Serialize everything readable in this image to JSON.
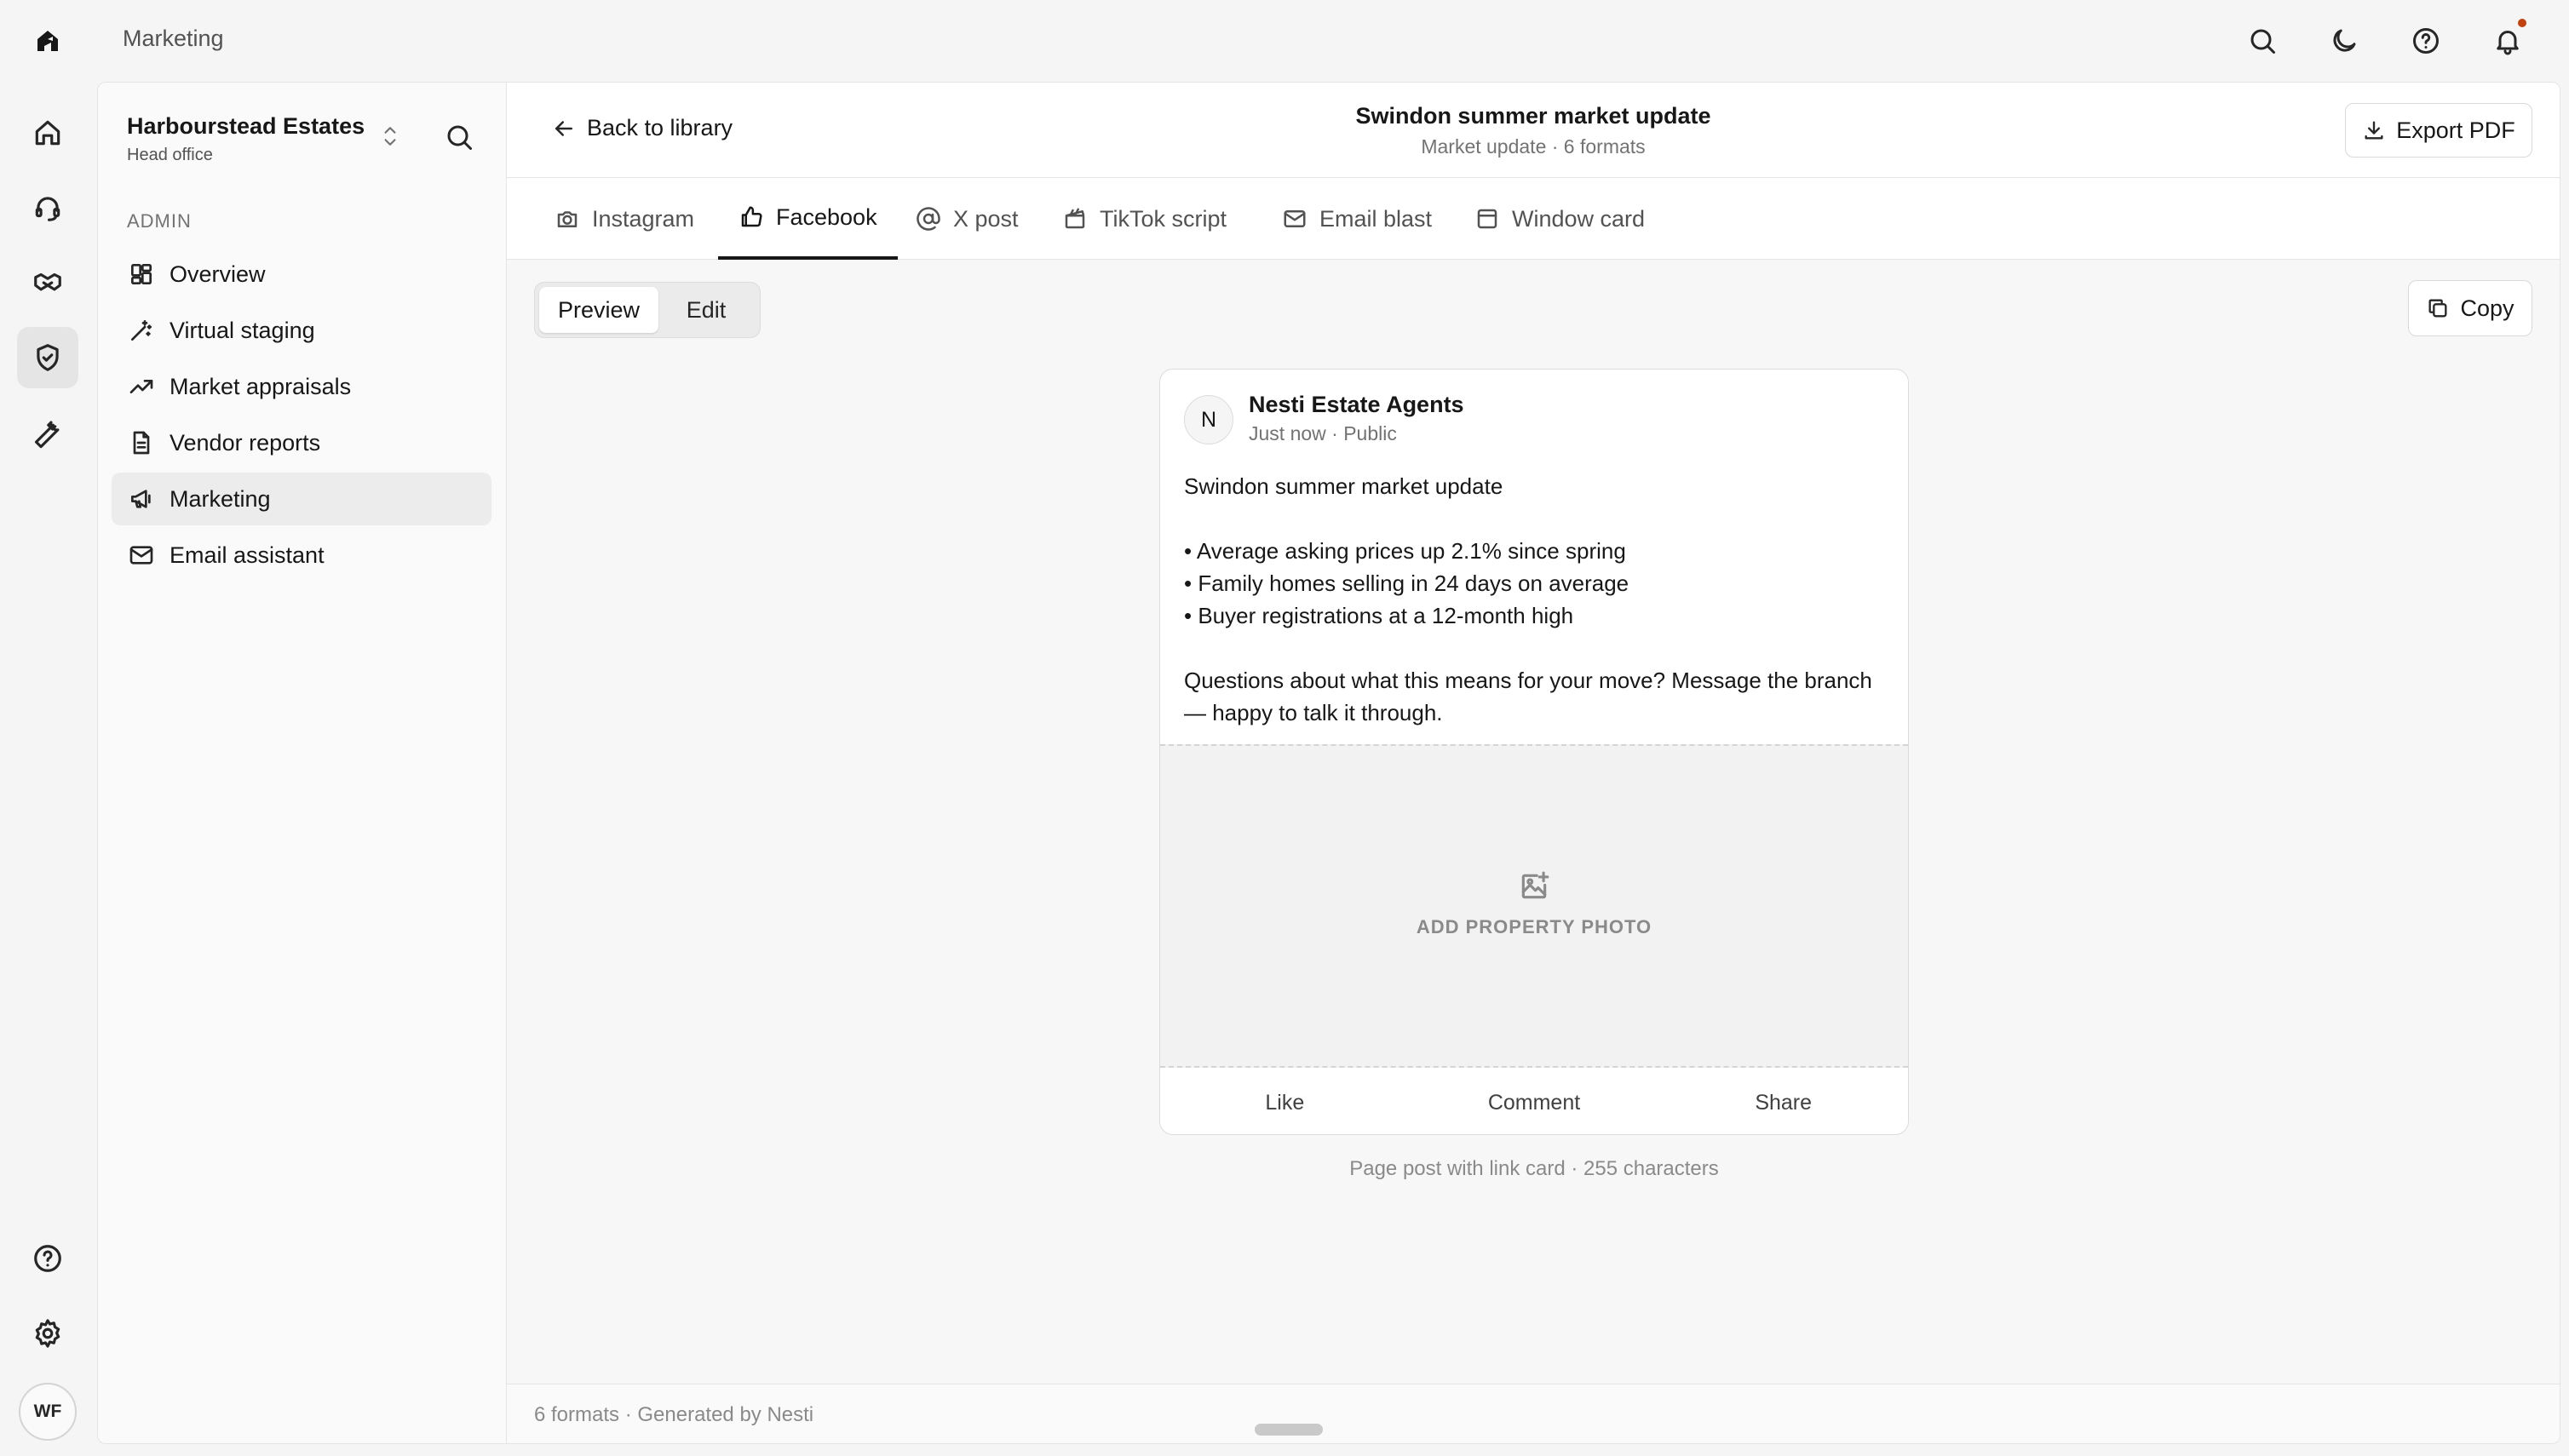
{
  "topbar": {
    "title": "Marketing",
    "icons": [
      "search-icon",
      "moon-icon",
      "help-icon",
      "bell-icon"
    ]
  },
  "rail": {
    "items": [
      "home-icon",
      "headset-icon",
      "handshake-icon",
      "shield-check-icon",
      "wrench-icon"
    ],
    "bottom": [
      "help-icon",
      "gear-icon"
    ],
    "user_initials": "WF"
  },
  "sidebar": {
    "org_name": "Harbourstead Estates",
    "org_sub": "Head office",
    "section_label": "ADMIN",
    "items": [
      {
        "label": "Overview",
        "icon": "grid-icon"
      },
      {
        "label": "Virtual staging",
        "icon": "wand-icon"
      },
      {
        "label": "Market appraisals",
        "icon": "trending-up-icon"
      },
      {
        "label": "Vendor reports",
        "icon": "document-icon"
      },
      {
        "label": "Marketing",
        "icon": "megaphone-icon",
        "active": true
      },
      {
        "label": "Email assistant",
        "icon": "mail-icon"
      }
    ]
  },
  "header": {
    "back_label": "Back to library",
    "title": "Swindon summer market update",
    "subtitle": "Market update · 6 formats",
    "export_label": "Export PDF"
  },
  "tabs": [
    {
      "label": "Instagram",
      "icon": "camera-icon"
    },
    {
      "label": "Facebook",
      "icon": "thumbs-up-icon",
      "active": true
    },
    {
      "label": "X post",
      "icon": "at-icon"
    },
    {
      "label": "TikTok script",
      "icon": "clapper-icon"
    },
    {
      "label": "Email blast",
      "icon": "mail-icon"
    },
    {
      "label": "Window card",
      "icon": "window-icon"
    }
  ],
  "mode": {
    "preview": "Preview",
    "edit": "Edit",
    "selected": "Preview"
  },
  "copy_label": "Copy",
  "post": {
    "avatar_initial": "N",
    "author": "Nesti Estate Agents",
    "meta": "Just now · Public",
    "title_line": "Swindon summer market update",
    "bullets": [
      "• Average asking prices up 2.1% since spring",
      "• Family homes selling in 24 days on average",
      "• Buyer registrations at a 12-month high"
    ],
    "cta": "Questions about what this means for your move? Message the branch — happy to talk it through.",
    "photo_label": "ADD PROPERTY PHOTO",
    "actions": [
      "Like",
      "Comment",
      "Share"
    ]
  },
  "caption": "Page post with link card · 255 characters",
  "footer": "6 formats · Generated by Nesti",
  "colors": {
    "accent": "#171717",
    "notification": "#c2410c",
    "panel": "#ffffff",
    "background": "#f5f5f5"
  }
}
